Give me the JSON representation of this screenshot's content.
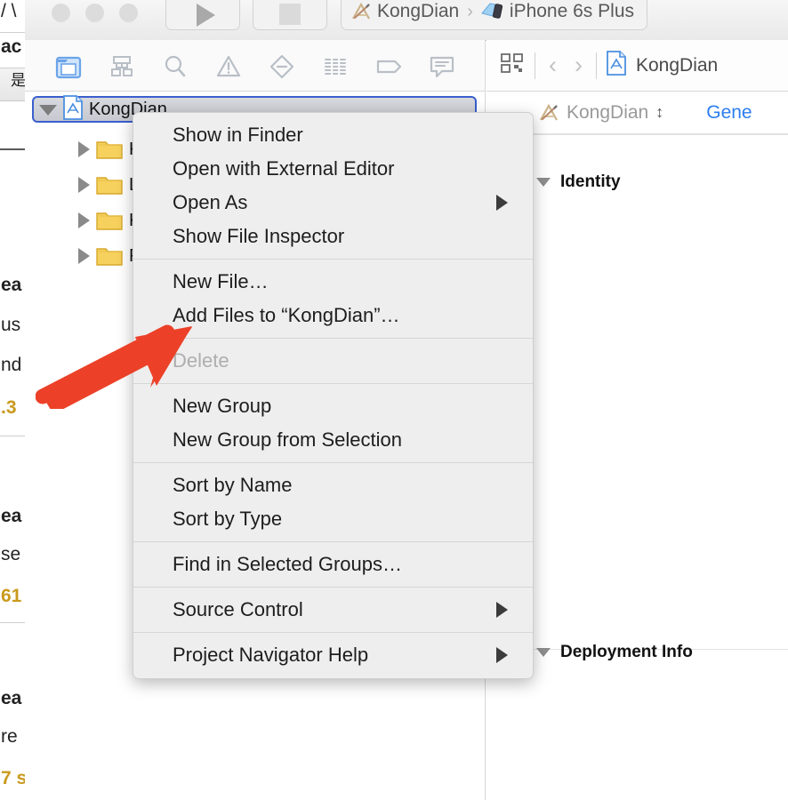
{
  "background_window": {
    "fragments": [
      {
        "text": "/ \\",
        "kind": "plain"
      },
      {
        "text": "ac",
        "kind": "plain"
      },
      {
        "text": "是",
        "kind": "header"
      },
      {
        "text": "ea",
        "kind": "bold"
      },
      {
        "text": "us",
        "kind": "plain"
      },
      {
        "text": "nd",
        "kind": "plain"
      },
      {
        "text": ".3",
        "kind": "gold"
      },
      {
        "text": "ea",
        "kind": "bold"
      },
      {
        "text": "se",
        "kind": "plain"
      },
      {
        "text": "61",
        "kind": "gold"
      },
      {
        "text": "ea",
        "kind": "bold"
      },
      {
        "text": "re",
        "kind": "plain"
      },
      {
        "text": "7 s",
        "kind": "gold"
      }
    ]
  },
  "titlebar": {
    "traffic_lights": [
      "close",
      "minimize",
      "maximize"
    ],
    "run_button": "run",
    "stop_button": "stop",
    "scheme": {
      "project": "KongDian",
      "separator": "›",
      "destination": "iPhone 6s Plus"
    }
  },
  "navigator": {
    "toolbar_icons": [
      {
        "name": "project-navigator-icon",
        "selected": true
      },
      {
        "name": "hierarchy-navigator-icon",
        "selected": false
      },
      {
        "name": "find-navigator-icon",
        "selected": false
      },
      {
        "name": "issue-navigator-icon",
        "selected": false
      },
      {
        "name": "test-navigator-icon",
        "selected": false
      },
      {
        "name": "debug-navigator-icon",
        "selected": false
      },
      {
        "name": "breakpoint-navigator-icon",
        "selected": false
      },
      {
        "name": "report-navigator-icon",
        "selected": false
      }
    ],
    "project_row": {
      "label": "KongDian",
      "expanded": true,
      "selected": true
    },
    "tree_rows": [
      {
        "label": "Ko",
        "type": "folder",
        "expanded": false
      },
      {
        "label": "Li",
        "type": "folder",
        "expanded": false
      },
      {
        "label": "Ko",
        "type": "folder",
        "expanded": false
      },
      {
        "label": "Pr",
        "type": "folder",
        "expanded": false
      }
    ]
  },
  "context_menu": {
    "groups": [
      {
        "items": [
          {
            "label": "Show in Finder",
            "disabled": false,
            "submenu": false
          },
          {
            "label": "Open with External Editor",
            "disabled": false,
            "submenu": false
          },
          {
            "label": "Open As",
            "disabled": false,
            "submenu": true
          },
          {
            "label": "Show File Inspector",
            "disabled": false,
            "submenu": false
          }
        ]
      },
      {
        "items": [
          {
            "label": "New File…",
            "disabled": false,
            "submenu": false
          },
          {
            "label": "Add Files to “KongDian”…",
            "disabled": false,
            "submenu": false
          }
        ]
      },
      {
        "items": [
          {
            "label": "Delete",
            "disabled": true,
            "submenu": false
          }
        ]
      },
      {
        "items": [
          {
            "label": "New Group",
            "disabled": false,
            "submenu": false
          },
          {
            "label": "New Group from Selection",
            "disabled": false,
            "submenu": false
          }
        ]
      },
      {
        "items": [
          {
            "label": "Sort by Name",
            "disabled": false,
            "submenu": false
          },
          {
            "label": "Sort by Type",
            "disabled": false,
            "submenu": false
          }
        ]
      },
      {
        "items": [
          {
            "label": "Find in Selected Groups…",
            "disabled": false,
            "submenu": false
          }
        ]
      },
      {
        "items": [
          {
            "label": "Source Control",
            "disabled": false,
            "submenu": true
          }
        ]
      },
      {
        "items": [
          {
            "label": "Project Navigator Help",
            "disabled": false,
            "submenu": true
          }
        ]
      }
    ]
  },
  "inspector": {
    "toolbar": {
      "related_items_icon": "related-items-icon",
      "back_label": "‹",
      "forward_label": "›",
      "document_title": "KongDian"
    },
    "jump_bar": {
      "target_name": "KongDian",
      "tab_label": "Gene"
    },
    "sections": [
      {
        "title": "Identity",
        "expanded": true
      },
      {
        "title": "Deployment Info",
        "expanded": true
      }
    ]
  },
  "annotation": {
    "arrow": {
      "color": "#ec4128",
      "direction": "up-right"
    }
  },
  "colors": {
    "accent_blue": "#2c7ef0",
    "selection_ring": "#3a5fcd",
    "menu_bg": "#eeeeee",
    "arrow_red": "#ec4128",
    "folder_yellow": "#f6cf56"
  }
}
